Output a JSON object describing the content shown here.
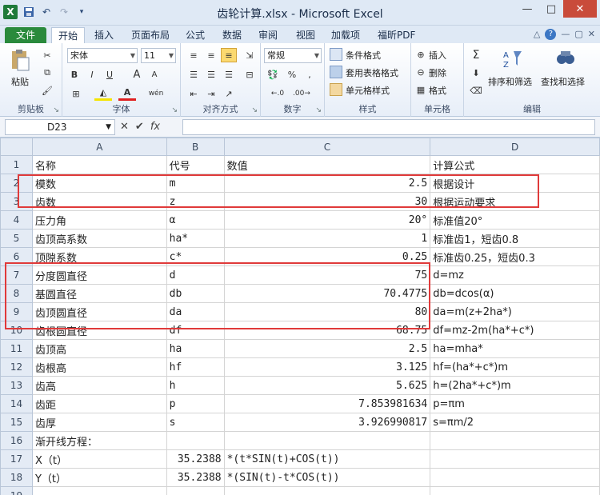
{
  "window": {
    "title": "齿轮计算.xlsx - Microsoft Excel",
    "logo": "X",
    "controls": [
      "—",
      "□",
      "✕"
    ]
  },
  "tabs": [
    "文件",
    "开始",
    "插入",
    "页面布局",
    "公式",
    "数据",
    "审阅",
    "视图",
    "加载项",
    "福昕PDF"
  ],
  "ribbon": {
    "clipboard": {
      "title": "剪贴板",
      "paste": "粘贴"
    },
    "font": {
      "title": "字体",
      "name": "宋体",
      "size": "11",
      "bold": "B",
      "italic": "I",
      "underline": "U",
      "grow": "A",
      "shrink": "A",
      "color_glyph": "A",
      "pinyin": "wén"
    },
    "align": {
      "title": "对齐方式"
    },
    "number": {
      "title": "数字",
      "format": "常规",
      "percent": "%",
      "comma": ","
    },
    "styles": {
      "title": "样式",
      "cond": "条件格式",
      "table": "套用表格格式",
      "cell": "单元格样式"
    },
    "cells": {
      "title": "单元格",
      "insert": "插入",
      "delete": "删除",
      "format": "格式"
    },
    "editing": {
      "title": "编辑",
      "sort": "排序和筛选",
      "find": "查找和选择",
      "sum": "Σ"
    }
  },
  "formula_bar": {
    "name_box": "D23",
    "fx": "fx",
    "formula": ""
  },
  "columns": [
    "A",
    "B",
    "C",
    "D"
  ],
  "rows": [
    {
      "n": "1",
      "a": "名称",
      "b": "代号",
      "c": "数值",
      "d": "计算公式"
    },
    {
      "n": "2",
      "a": "模数",
      "b": "m",
      "c": "2.5",
      "d": "根据设计"
    },
    {
      "n": "3",
      "a": "齿数",
      "b": "z",
      "c": "30",
      "d": "根据运动要求"
    },
    {
      "n": "4",
      "a": "压力角",
      "b": "α",
      "c": "20°",
      "d": "标准值20°"
    },
    {
      "n": "5",
      "a": "齿顶高系数",
      "b": "ha*",
      "c": "1",
      "d": "标准齿1，短齿0.8"
    },
    {
      "n": "6",
      "a": "顶隙系数",
      "b": "c*",
      "c": "0.25",
      "d": "标准齿0.25，短齿0.3"
    },
    {
      "n": "7",
      "a": "分度圆直径",
      "b": "d",
      "c": "75",
      "d": "d=mz"
    },
    {
      "n": "8",
      "a": "基圆直径",
      "b": "db",
      "c": "70.4775",
      "d": "db=dcos(α)"
    },
    {
      "n": "9",
      "a": "齿顶圆直径",
      "b": "da",
      "c": "80",
      "d": "da=m(z+2ha*)"
    },
    {
      "n": "10",
      "a": "齿根圆直径",
      "b": "df",
      "c": "68.75",
      "d": "df=mz-2m(ha*+c*)"
    },
    {
      "n": "11",
      "a": "齿顶高",
      "b": "ha",
      "c": "2.5",
      "d": "ha=mha*"
    },
    {
      "n": "12",
      "a": "齿根高",
      "b": "hf",
      "c": "3.125",
      "d": "hf=(ha*+c*)m"
    },
    {
      "n": "13",
      "a": "齿高",
      "b": "h",
      "c": "5.625",
      "d": "h=(2ha*+c*)m"
    },
    {
      "n": "14",
      "a": "齿距",
      "b": "p",
      "c": "7.853981634",
      "d": "p=πm"
    },
    {
      "n": "15",
      "a": "齿厚",
      "b": "s",
      "c": "3.926990817",
      "d": "s=πm/2"
    },
    {
      "n": "16",
      "a": "渐开线方程：",
      "b": "",
      "c": "",
      "d": ""
    },
    {
      "n": "17",
      "a": "X（t）",
      "b": "35.2388",
      "c": "*(t*SIN(t)+COS(t))",
      "d": ""
    },
    {
      "n": "18",
      "a": "Y（t）",
      "b": "35.2388",
      "c": "*(SIN(t)-t*COS(t))",
      "d": ""
    },
    {
      "n": "19",
      "a": "",
      "b": "",
      "c": "",
      "d": ""
    }
  ],
  "colors": {
    "highlight": "#e03a3a",
    "file_tab": "#2a8a3c"
  }
}
